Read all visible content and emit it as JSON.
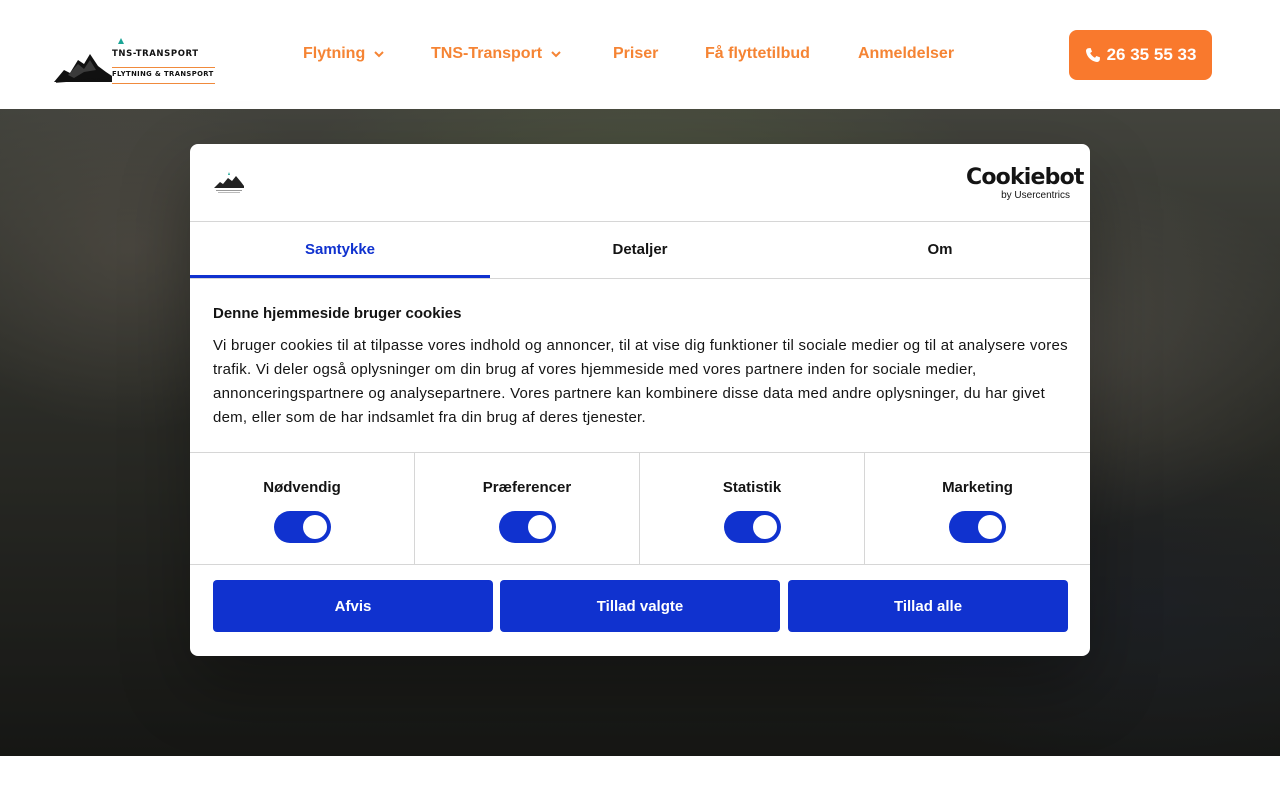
{
  "header": {
    "logo": {
      "line1": "TNS-TRANSPORT",
      "line2": "FLYTNING & TRANSPORT"
    },
    "nav": [
      {
        "label": "Flytning",
        "has_dropdown": true
      },
      {
        "label": "TNS-Transport",
        "has_dropdown": true
      },
      {
        "label": "Priser",
        "has_dropdown": false
      },
      {
        "label": "Få flyttetilbud",
        "has_dropdown": false
      },
      {
        "label": "Anmeldelser",
        "has_dropdown": false
      }
    ],
    "phone": {
      "label": "26 35 55 33",
      "icon": "phone-icon"
    }
  },
  "cookie_dialog": {
    "brand": {
      "name": "Cookiebot",
      "sub": "by Usercentrics"
    },
    "tabs": [
      {
        "label": "Samtykke",
        "active": true
      },
      {
        "label": "Detaljer",
        "active": false
      },
      {
        "label": "Om",
        "active": false
      }
    ],
    "title": "Denne hjemmeside bruger cookies",
    "text": "Vi bruger cookies til at tilpasse vores indhold og annoncer, til at vise dig funktioner til sociale medier og til at analysere vores trafik. Vi deler også oplysninger om din brug af vores hjemmeside med vores partnere inden for sociale medier, annonceringspartnere og analysepartnere. Vores partnere kan kombinere disse data med andre oplysninger, du har givet dem, eller som de har indsamlet fra din brug af deres tjenester.",
    "categories": [
      {
        "label": "Nødvendig",
        "enabled": true
      },
      {
        "label": "Præferencer",
        "enabled": true
      },
      {
        "label": "Statistik",
        "enabled": true
      },
      {
        "label": "Marketing",
        "enabled": true
      }
    ],
    "buttons": {
      "deny": "Afvis",
      "allow_selected": "Tillad valgte",
      "allow_all": "Tillad alle"
    }
  },
  "colors": {
    "accent_orange": "#f58434",
    "phone_button": "#f9792d",
    "cookiebot_blue": "#1032cf"
  }
}
